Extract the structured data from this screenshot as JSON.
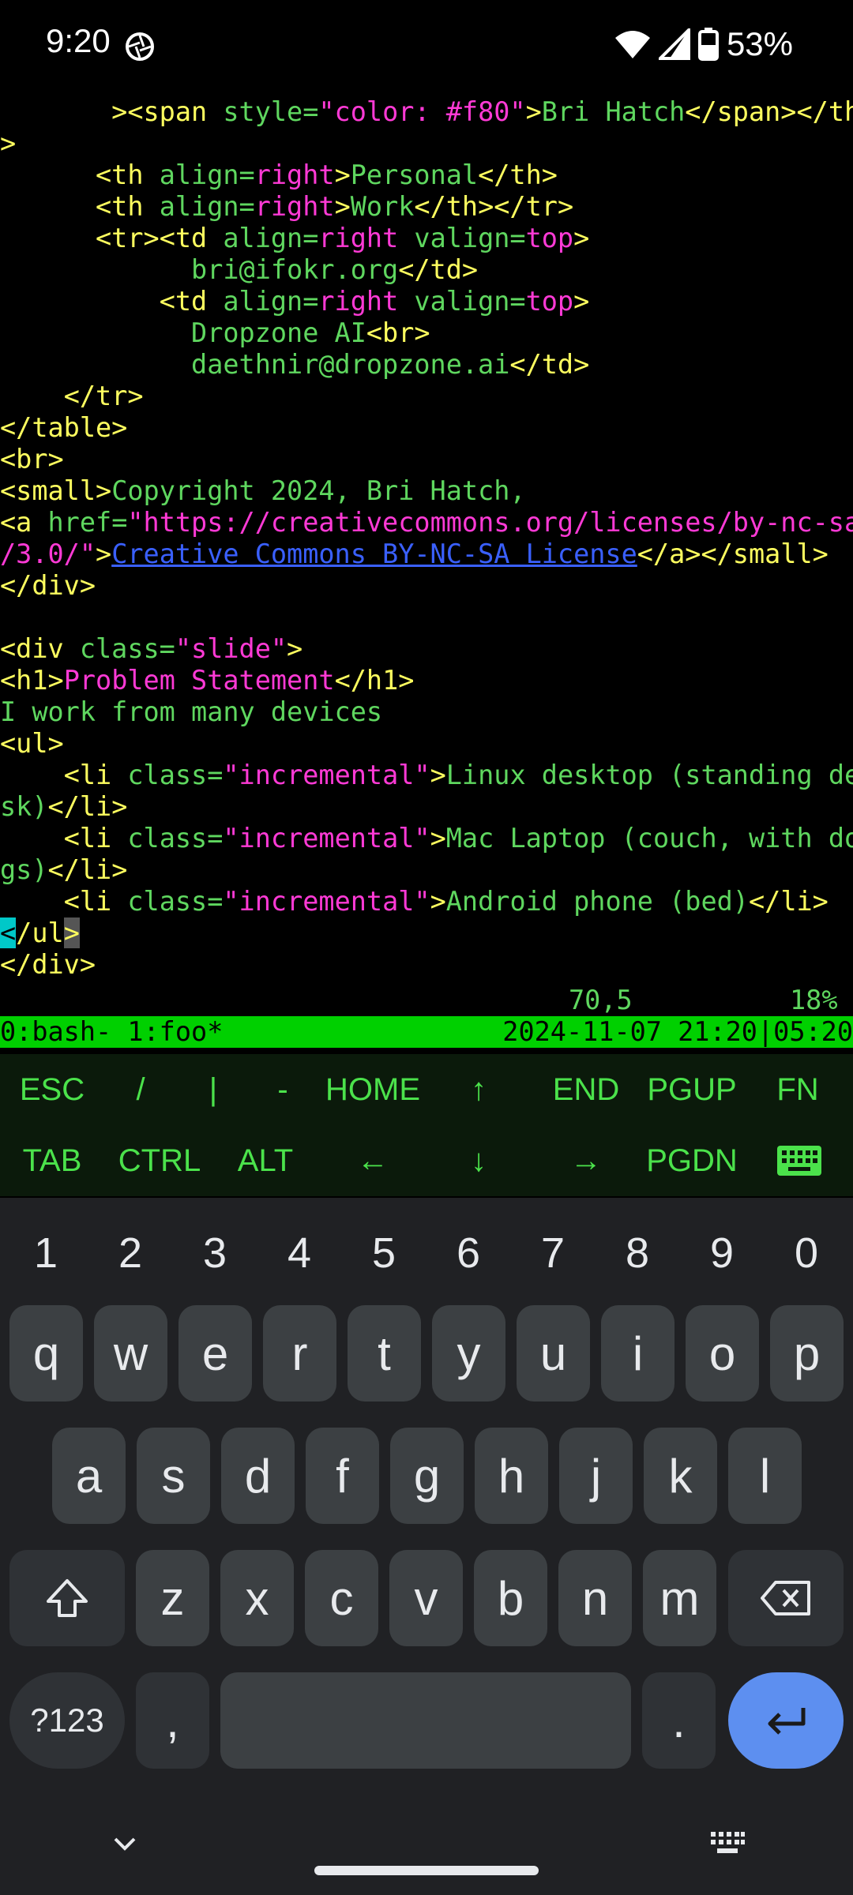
{
  "status": {
    "time": "9:20",
    "battery": "53%"
  },
  "terminal": {
    "lines": [
      [
        [
          "tag",
          "       ><span "
        ],
        [
          "attr",
          "style="
        ],
        [
          "val",
          "\"color: #f80\""
        ],
        [
          "tag",
          ">"
        ],
        [
          "txt",
          "Bri Hatch"
        ],
        [
          "tag",
          "</span></th"
        ]
      ],
      [
        [
          "tag",
          ">"
        ]
      ],
      [
        [
          "txt",
          "      "
        ],
        [
          "tag",
          "<th "
        ],
        [
          "attr",
          "align="
        ],
        [
          "val",
          "right"
        ],
        [
          "tag",
          ">"
        ],
        [
          "txt",
          "Personal"
        ],
        [
          "tag",
          "</th>"
        ]
      ],
      [
        [
          "txt",
          "      "
        ],
        [
          "tag",
          "<th "
        ],
        [
          "attr",
          "align="
        ],
        [
          "val",
          "right"
        ],
        [
          "tag",
          ">"
        ],
        [
          "txt",
          "Work"
        ],
        [
          "tag",
          "</th></tr>"
        ]
      ],
      [
        [
          "txt",
          "      "
        ],
        [
          "tag",
          "<tr><td "
        ],
        [
          "attr",
          "align="
        ],
        [
          "val",
          "right "
        ],
        [
          "attr",
          "valign="
        ],
        [
          "val",
          "top"
        ],
        [
          "tag",
          ">"
        ]
      ],
      [
        [
          "txt",
          "            bri@ifokr.org"
        ],
        [
          "tag",
          "</td>"
        ]
      ],
      [
        [
          "txt",
          "          "
        ],
        [
          "tag",
          "<td "
        ],
        [
          "attr",
          "align="
        ],
        [
          "val",
          "right "
        ],
        [
          "attr",
          "valign="
        ],
        [
          "val",
          "top"
        ],
        [
          "tag",
          ">"
        ]
      ],
      [
        [
          "txt",
          "            Dropzone AI"
        ],
        [
          "tag",
          "<br>"
        ]
      ],
      [
        [
          "txt",
          "            daethnir@dropzone.ai"
        ],
        [
          "tag",
          "</td>"
        ]
      ],
      [
        [
          "txt",
          "    "
        ],
        [
          "tag",
          "</tr>"
        ]
      ],
      [
        [
          "tag",
          "</table>"
        ]
      ],
      [
        [
          "tag",
          "<br>"
        ]
      ],
      [
        [
          "tag",
          "<small>"
        ],
        [
          "txt",
          "Copyright 2024, Bri Hatch,"
        ]
      ],
      [
        [
          "tag",
          "<a "
        ],
        [
          "attr",
          "href="
        ],
        [
          "url",
          "\"https://creativecommons.org/licenses/by-nc-sa"
        ]
      ],
      [
        [
          "url",
          "/3.0/\""
        ],
        [
          "tag",
          ">"
        ],
        [
          "link",
          "Creative Commons BY-NC-SA License"
        ],
        [
          "tag",
          "</a></small>"
        ]
      ],
      [
        [
          "tag",
          "</div>"
        ]
      ],
      [
        [
          "txt",
          ""
        ]
      ],
      [
        [
          "tag",
          "<div "
        ],
        [
          "attr",
          "class="
        ],
        [
          "val",
          "\"slide\""
        ],
        [
          "tag",
          ">"
        ]
      ],
      [
        [
          "tag",
          "<h1>"
        ],
        [
          "val",
          "Problem Statement"
        ],
        [
          "tag",
          "</h1>"
        ]
      ],
      [
        [
          "txt",
          "I work from many devices"
        ]
      ],
      [
        [
          "tag",
          "<ul>"
        ]
      ],
      [
        [
          "txt",
          "    "
        ],
        [
          "tag",
          "<li "
        ],
        [
          "attr",
          "class="
        ],
        [
          "val",
          "\"incremental\""
        ],
        [
          "tag",
          ">"
        ],
        [
          "txt",
          "Linux desktop (standing de"
        ]
      ],
      [
        [
          "txt",
          "sk)"
        ],
        [
          "tag",
          "</li>"
        ]
      ],
      [
        [
          "txt",
          "    "
        ],
        [
          "tag",
          "<li "
        ],
        [
          "attr",
          "class="
        ],
        [
          "val",
          "\"incremental\""
        ],
        [
          "tag",
          ">"
        ],
        [
          "txt",
          "Mac Laptop (couch, with do"
        ]
      ],
      [
        [
          "txt",
          "gs)"
        ],
        [
          "tag",
          "</li>"
        ]
      ],
      [
        [
          "txt",
          "    "
        ],
        [
          "tag",
          "<li "
        ],
        [
          "attr",
          "class="
        ],
        [
          "val",
          "\"incremental\""
        ],
        [
          "tag",
          ">"
        ],
        [
          "txt",
          "Android phone (bed)"
        ],
        [
          "tag",
          "</li>"
        ]
      ],
      [
        [
          "cursor",
          "<"
        ],
        [
          "tag",
          "/ul"
        ],
        [
          "ghost",
          ">"
        ]
      ],
      [
        [
          "tag",
          "</div>"
        ]
      ]
    ],
    "ruler_pos": "70,5",
    "ruler_pct": "18%",
    "tmux_left": "0:bash- 1:foo*",
    "tmux_right": "2024-11-07 21:20|05:20"
  },
  "extra_keys": {
    "row1": [
      "ESC",
      "/",
      "|",
      "-",
      "HOME",
      "↑",
      "END",
      "PGUP",
      "FN"
    ],
    "row2": [
      "TAB",
      "CTRL",
      "ALT",
      "←",
      "↓",
      "→",
      "PGDN"
    ],
    "keyboard_icon": "keyboard-icon"
  },
  "keyboard": {
    "numbers": [
      "1",
      "2",
      "3",
      "4",
      "5",
      "6",
      "7",
      "8",
      "9",
      "0"
    ],
    "row1": [
      "q",
      "w",
      "e",
      "r",
      "t",
      "y",
      "u",
      "i",
      "o",
      "p"
    ],
    "row2": [
      "a",
      "s",
      "d",
      "f",
      "g",
      "h",
      "j",
      "k",
      "l"
    ],
    "row3": [
      "z",
      "x",
      "c",
      "v",
      "b",
      "n",
      "m"
    ],
    "symbols_label": "?123",
    "comma": ",",
    "period": ".",
    "icons": {
      "shift": "shift-icon",
      "backspace": "backspace-icon",
      "enter": "enter-icon",
      "hide": "chevron-down-icon",
      "switch": "keyboard-switch-icon"
    },
    "colors": {
      "key": "#3c4043",
      "enter": "#5d8ff0",
      "background": "#202124"
    }
  },
  "colors": {
    "tag": "#ffff5f",
    "attr": "#5fd75f",
    "value": "#ff3ad6",
    "link": "#3a60ff",
    "tmux_bar": "#00d000",
    "extra_key_text": "#4be24b"
  }
}
